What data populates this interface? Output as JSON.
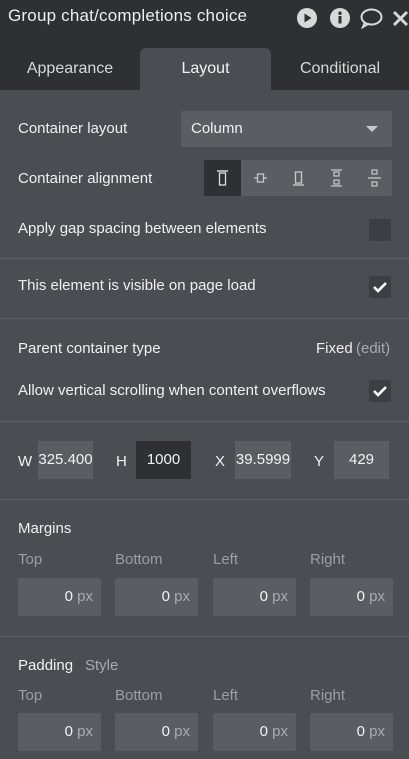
{
  "window": {
    "title": "Group chat/completions choice",
    "icons": [
      "play-icon",
      "info-icon",
      "comment-icon",
      "close-icon"
    ]
  },
  "tabs": [
    {
      "label": "Appearance",
      "active": false
    },
    {
      "label": "Layout",
      "active": true
    },
    {
      "label": "Conditional",
      "active": false
    }
  ],
  "layout": {
    "container_layout_label": "Container layout",
    "container_layout_value": "Column",
    "container_alignment_label": "Container alignment",
    "alignment_icons": [
      "align-top-icon",
      "align-center-icon",
      "align-bottom-icon",
      "align-space-between-icon",
      "align-space-around-icon"
    ],
    "alignment_active_index": 0,
    "gap_label": "Apply gap spacing between elements",
    "gap_checked": false,
    "visible_label": "This element is visible on page load",
    "visible_checked": true,
    "parent_type_label": "Parent container type",
    "parent_type_value": "Fixed",
    "parent_type_edit": "(edit)",
    "scroll_label": "Allow vertical scrolling when content overflows",
    "scroll_checked": true
  },
  "dimensions": {
    "w_label": "W",
    "w_value": "325.400",
    "h_label": "H",
    "h_value": "1000",
    "x_label": "X",
    "x_value": "39.5999",
    "y_label": "Y",
    "y_value": "429"
  },
  "margins": {
    "title": "Margins",
    "top_label": "Top",
    "top_value": "0",
    "bottom_label": "Bottom",
    "bottom_value": "0",
    "left_label": "Left",
    "left_value": "0",
    "right_label": "Right",
    "right_value": "0",
    "unit": "px"
  },
  "padding": {
    "title": "Padding",
    "style_link": "Style",
    "top_label": "Top",
    "top_value": "0",
    "bottom_label": "Bottom",
    "bottom_value": "0",
    "left_label": "Left",
    "left_value": "0",
    "right_label": "Right",
    "right_value": "0",
    "unit": "px"
  },
  "colors": {
    "panel_bg": "#4a4d51",
    "header_bg": "#2e3033",
    "field_bg": "#5a5d62",
    "muted_text": "#a9abaf"
  }
}
